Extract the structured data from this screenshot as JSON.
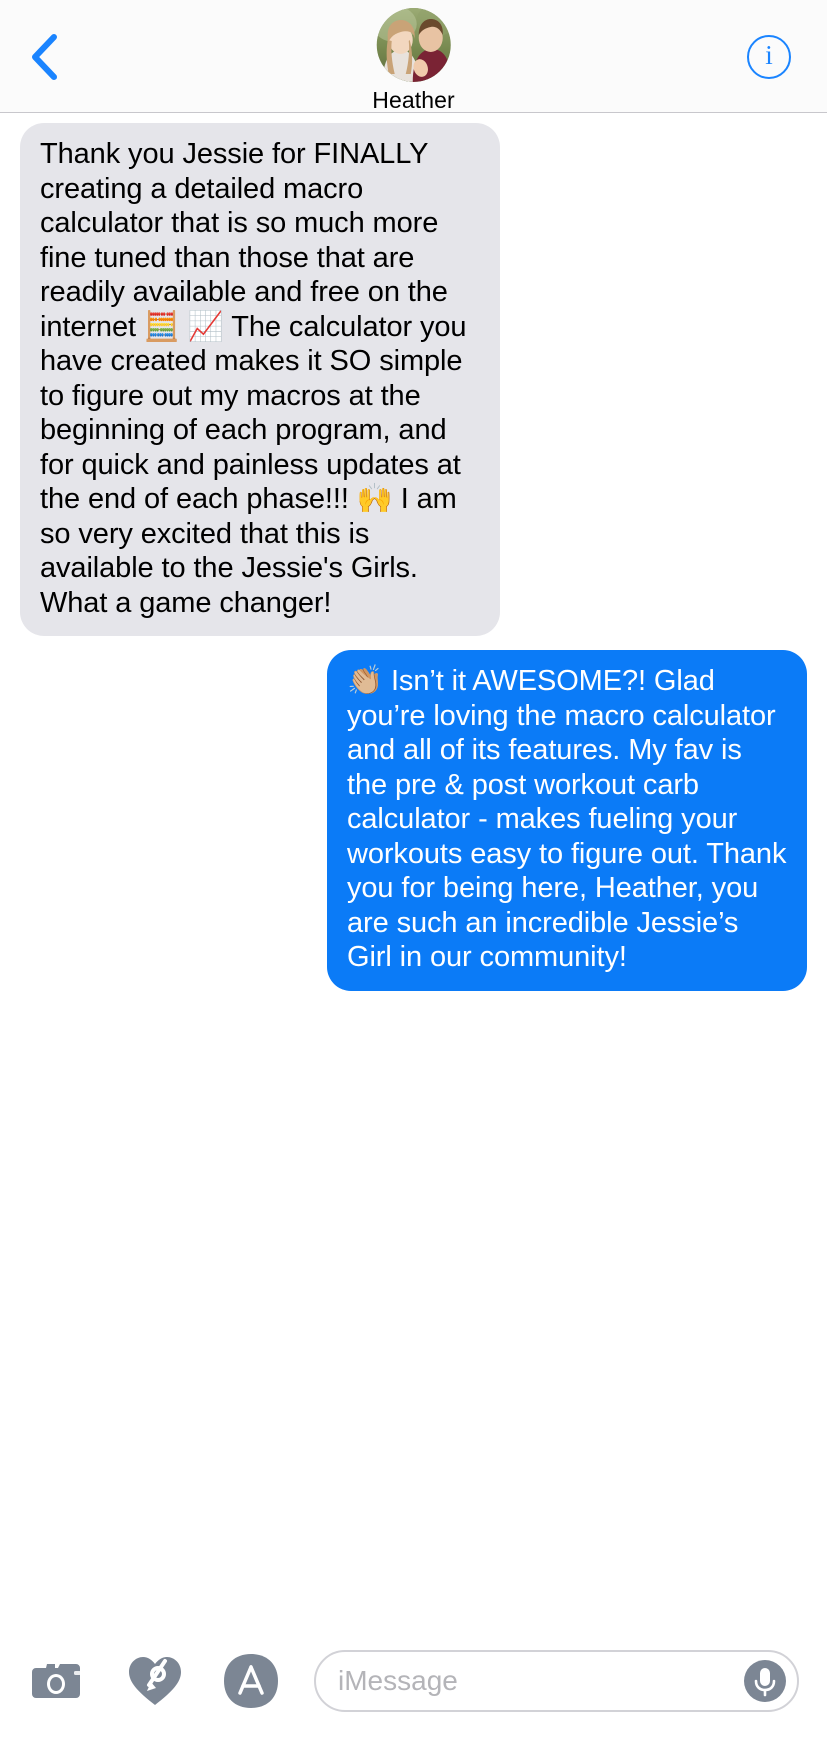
{
  "header": {
    "back_icon": "chevron-left-icon",
    "contact_name": "Heather",
    "avatar_icon": "contact-avatar-photo",
    "info_label": "i",
    "info_icon": "info-circle-icon"
  },
  "conversation": {
    "messages": [
      {
        "id": "message-1",
        "direction": "incoming",
        "sender": "Heather",
        "text": "Thank you Jessie for FINALLY creating a detailed macro calculator that is so much more fine tuned than those that are readily available and free on the internet 🧮 📈 The calculator you have created makes it SO simple to figure out my macros at the beginning of each program, and for quick and painless updates at the end of each phase!!! 🙌 I am so very excited that this is available to the Jessie's Girls. What a game changer!",
        "bubble_color": "#e5e5ea",
        "text_color": "#000000"
      },
      {
        "id": "message-2",
        "direction": "outgoing",
        "sender": "Me",
        "text": "👏🏼 Isn’t it AWESOME?! Glad you’re loving the macro calculator and all of its features. My fav is the pre & post workout carb calculator - makes fueling your workouts easy to figure out. Thank you for being here, Heather, you are such an incredible Jessie’s Girl in our community!",
        "bubble_color": "#0b7bf7",
        "text_color": "#ffffff"
      }
    ]
  },
  "toolbar": {
    "camera_icon": "camera-icon",
    "digital_touch_icon": "digital-touch-heart-icon",
    "app_store_icon": "app-store-icon",
    "input_placeholder": "iMessage",
    "input_value": "",
    "mic_icon": "microphone-icon"
  },
  "colors": {
    "accent_blue": "#1a84ff",
    "outgoing_bubble": "#0b7bf7",
    "incoming_bubble": "#e5e5ea",
    "toolbar_icon_gray": "#7c8694",
    "placeholder_gray": "#b4b4b8"
  }
}
